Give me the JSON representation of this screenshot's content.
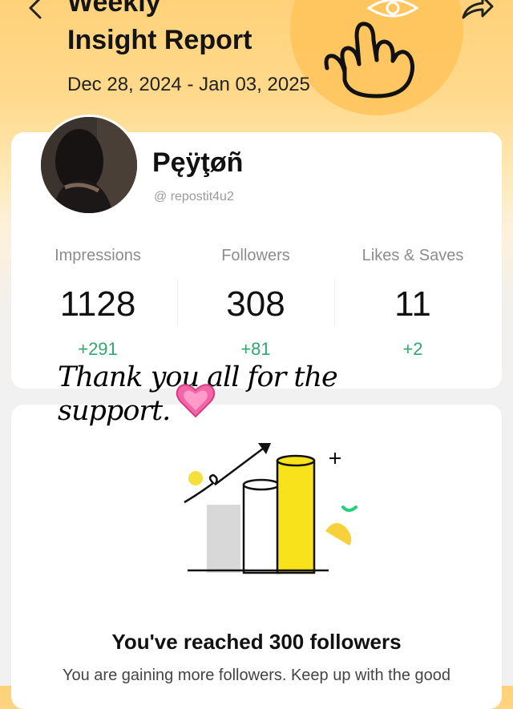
{
  "header": {
    "title_line1": "Weekly",
    "title_line2": "Insight Report",
    "date_range": "Dec 28, 2024 - Jan 03, 2025",
    "accent_color": "#ffc35a"
  },
  "profile": {
    "display_name": "Pęÿţøñ",
    "handle": "@ repostit4u2"
  },
  "stats": [
    {
      "label": "Impressions",
      "value": "1128",
      "delta": "+291"
    },
    {
      "label": "Followers",
      "value": "308",
      "delta": "+81"
    },
    {
      "label": "Likes & Saves",
      "value": "11",
      "delta": "+2"
    }
  ],
  "handwritten_note": {
    "line1": "Thank you all for the",
    "line2": "support."
  },
  "milestone": {
    "title": "You've reached 300 followers",
    "subtitle": "You are gaining more followers. Keep up with the good"
  },
  "icons": {
    "back": "chevron-left-icon",
    "share": "share-arrow-icon",
    "heart": "heart-emoji-icon"
  },
  "colors": {
    "delta_positive": "#2fa86b",
    "bar_highlight": "#f7e21b"
  }
}
